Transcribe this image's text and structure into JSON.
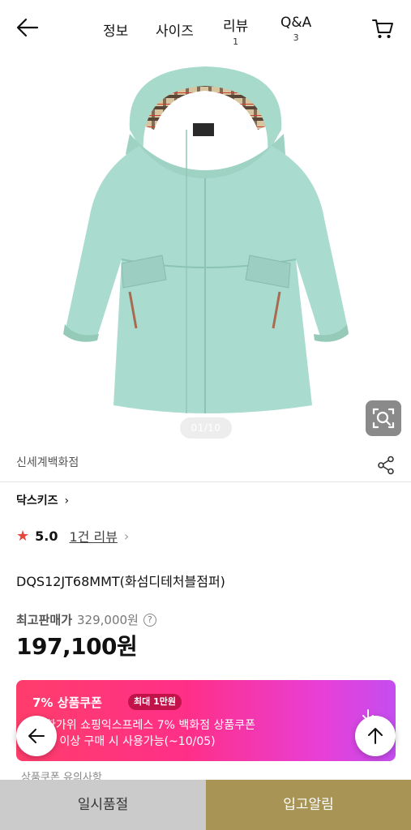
{
  "header": {
    "tabs": [
      {
        "label": "정보",
        "count": ""
      },
      {
        "label": "사이즈",
        "count": ""
      },
      {
        "label": "리뷰",
        "count": "1"
      },
      {
        "label": "Q&A",
        "count": "3"
      }
    ],
    "icons": {
      "back": "arrow-left-icon",
      "cart": "cart-icon"
    }
  },
  "gallery": {
    "indicator": "01/10",
    "icons": {
      "lens": "image-search-icon"
    }
  },
  "store": {
    "name": "신세계백화점",
    "share_icon": "share-icon"
  },
  "brand": {
    "name": "닥스키즈",
    "chevron": "›"
  },
  "rating": {
    "star": "★",
    "score": "5.0",
    "review_link": "1건 리뷰",
    "chevron": "›"
  },
  "product": {
    "name": "DQS12JT68MMT(화섬디테처블점퍼)"
  },
  "price": {
    "original_label": "최고판매가",
    "original_value": "329,000원",
    "help": "?",
    "sale_value": "197,100원"
  },
  "coupon": {
    "title": "7% 상품쿠폰",
    "badge": "최대 1만원",
    "line1": "한가위 쇼핑익스프레스 7% 백화점 상품쿠폰",
    "line2": "원 이상 구매 시 사용가능(~10/05)",
    "colors": {
      "start": "#ff3d6b",
      "end": "#c54df0"
    }
  },
  "notice": {
    "text": "상품쿠폰 유의사항"
  },
  "bottom": {
    "soldout_label": "일시품절",
    "restock_label": "입고알림",
    "colors": {
      "soldout": "#cbcbcb",
      "restock": "#a89454"
    }
  }
}
